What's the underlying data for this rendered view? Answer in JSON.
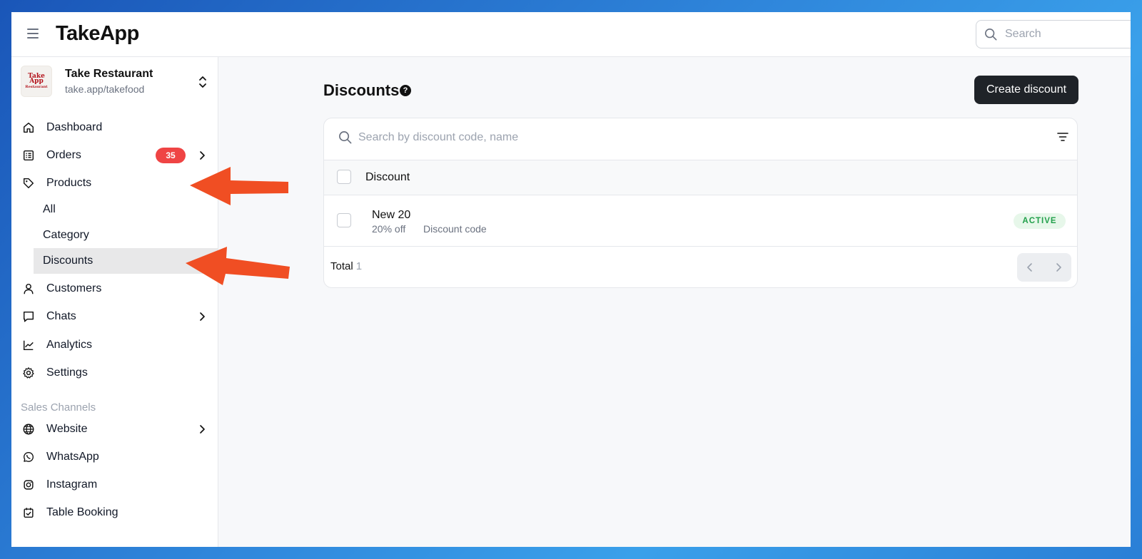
{
  "app": {
    "title": "TakeApp"
  },
  "topbar": {
    "search_placeholder": "Search"
  },
  "store": {
    "name": "Take Restaurant",
    "url": "take.app/takefood",
    "logo_lines": [
      "Take",
      "App",
      "Restaurant"
    ]
  },
  "nav": {
    "dashboard": "Dashboard",
    "orders": "Orders",
    "orders_badge": "35",
    "products": "Products",
    "products_sub": [
      "All",
      "Category",
      "Discounts"
    ],
    "customers": "Customers",
    "chats": "Chats",
    "analytics": "Analytics",
    "settings": "Settings"
  },
  "sales_channels": {
    "label": "Sales Channels",
    "items": [
      "Website",
      "WhatsApp",
      "Instagram",
      "Table Booking"
    ]
  },
  "main": {
    "title": "Discounts",
    "help": "?",
    "create_label": "Create discount",
    "search_placeholder": "Search by discount code, name",
    "column_header": "Discount",
    "rows": [
      {
        "name": "New 20",
        "value": "20% off",
        "type": "Discount code",
        "status": "ACTIVE"
      }
    ],
    "total_label": "Total",
    "total_count": "1"
  },
  "colors": {
    "badge": "#ef4444",
    "primary_button": "#1f2328",
    "active_status_text": "#22a04b",
    "active_status_bg": "#e7f7ea",
    "annotation_arrow": "#f04e23"
  },
  "icons": [
    "hamburger-icon",
    "search-icon",
    "chevron-up-down-icon",
    "home-icon",
    "orders-list-icon",
    "tag-icon",
    "user-icon",
    "chat-bubble-icon",
    "chart-line-icon",
    "gear-icon",
    "globe-icon",
    "whatsapp-icon",
    "instagram-icon",
    "calendar-check-icon",
    "chevron-right-icon",
    "filter-icon",
    "chevron-left-icon"
  ]
}
